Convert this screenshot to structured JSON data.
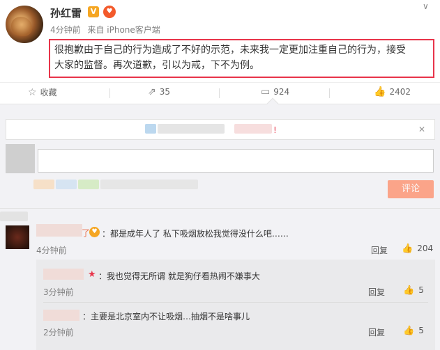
{
  "post": {
    "username": "孙红雷",
    "verified_badge": "V",
    "member_icon": "heart-member-icon",
    "time": "4分钟前",
    "source": "来自 iPhone客户端",
    "text_line1": "很抱歉由于自己的行为造成了不好的示范，未来我一定更加注重自己的行为，接受",
    "text_line2": "大家的监督。再次道歉，引以为戒，下不为例。"
  },
  "actions": {
    "favorite_label": "收藏",
    "repost_count": "35",
    "comment_count": "924",
    "like_count": "2402"
  },
  "compose": {
    "notice_mark": "!",
    "submit_label": "评论"
  },
  "comments": [
    {
      "name_suffix": "了",
      "text": "：都是成年人了 私下吸烟放松我觉得没什么吧……",
      "time": "4分钟前",
      "reply_label": "回复",
      "likes": "204",
      "replies": [
        {
          "text": "：我也觉得无所谓 就是狗仔看热闹不嫌事大",
          "time": "3分钟前",
          "reply_label": "回复",
          "likes": "5"
        },
        {
          "text": "：主要是北京室内不让吸烟…抽烟不是啥事儿",
          "time": "2分钟前",
          "reply_label": "回复",
          "likes": "5"
        }
      ]
    }
  ],
  "colors": {
    "highlight_border": "#e8344a",
    "submit_button": "#ff8a66",
    "name_orange": "#eb7350"
  }
}
